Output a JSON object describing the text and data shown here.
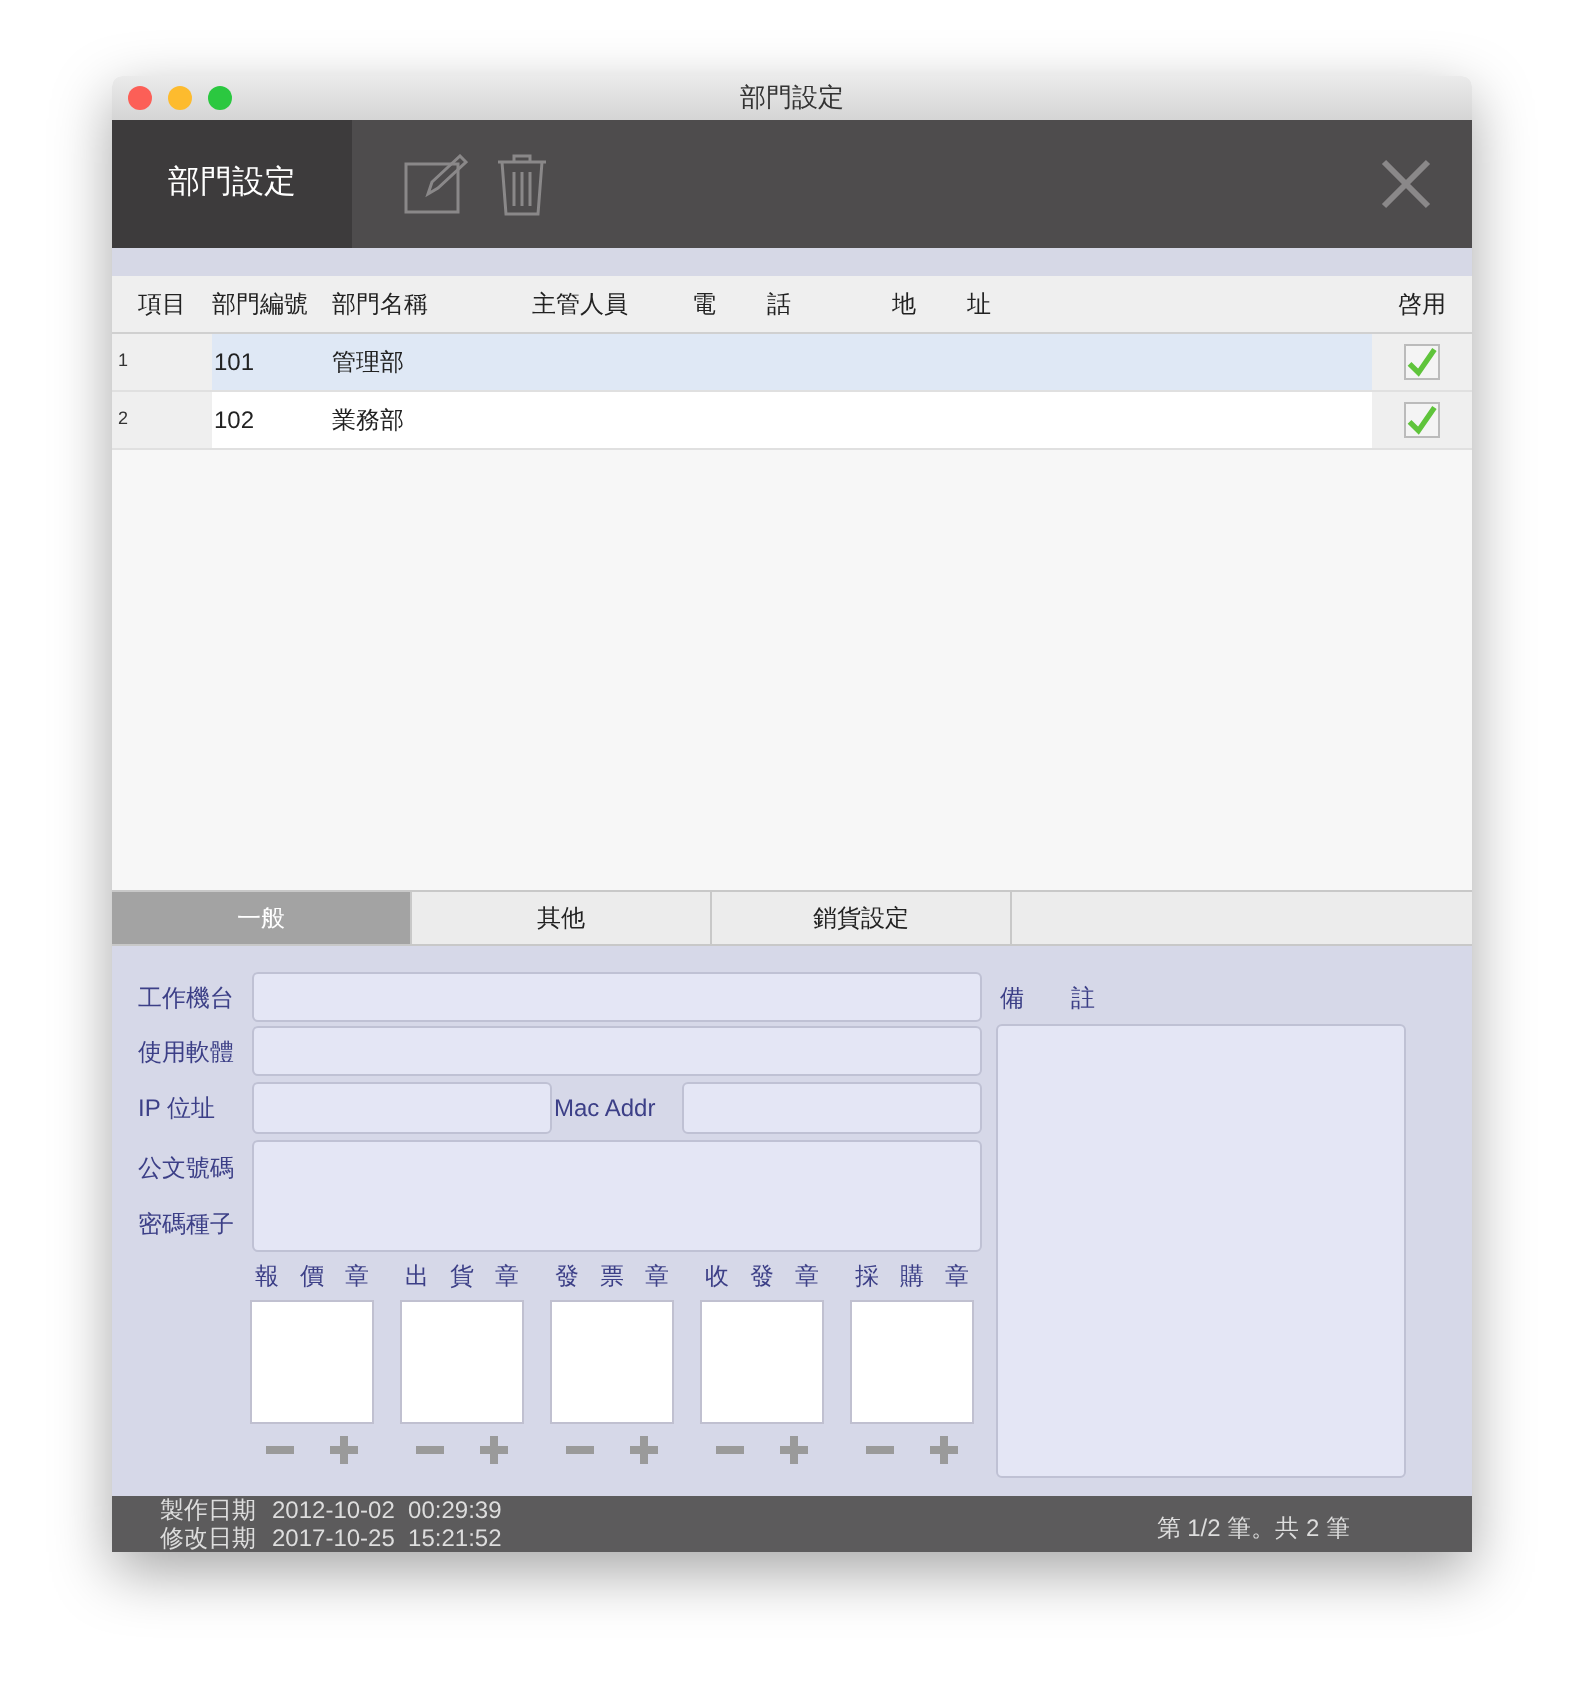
{
  "window": {
    "title": "部門設定"
  },
  "toolbar": {
    "tab": "部門設定"
  },
  "table": {
    "columns": [
      {
        "label": "項目"
      },
      {
        "label": "部門編號"
      },
      {
        "label": "部門名稱"
      },
      {
        "label": "主管人員"
      },
      {
        "label": "電 話"
      },
      {
        "label": "地 址"
      },
      {
        "label": "啓用"
      }
    ],
    "rows": [
      {
        "item": "1",
        "code": "101",
        "name": "管理部",
        "enabled": true,
        "selected": true
      },
      {
        "item": "2",
        "code": "102",
        "name": "業務部",
        "enabled": true,
        "selected": false
      }
    ]
  },
  "tabs": [
    {
      "label": "一般",
      "selected": true
    },
    {
      "label": "其他",
      "selected": false
    },
    {
      "label": "銷貨設定",
      "selected": false
    }
  ],
  "form": {
    "rows": [
      {
        "kind": "single",
        "label": "工作機台"
      },
      {
        "kind": "single",
        "label": "使用軟體"
      },
      {
        "kind": "pair",
        "label": "IP 位址",
        "label2": "Mac Addr"
      },
      {
        "kind": "multi",
        "label": "公文號碼",
        "label2": "密碼種子"
      }
    ],
    "stamps": [
      {
        "label": "報 價 章"
      },
      {
        "label": "出 貨 章"
      },
      {
        "label": "發 票 章"
      },
      {
        "label": "收 發 章"
      },
      {
        "label": "採 購 章"
      }
    ],
    "remark": {
      "label": "備 註"
    }
  },
  "status_bar": {
    "created_label": "製作日期",
    "created": "2012-10-02  00:29:39",
    "modified_label": "修改日期",
    "modified": "2017-10-25  15:21:52",
    "record": "第 1/2 筆。共 2 筆"
  }
}
